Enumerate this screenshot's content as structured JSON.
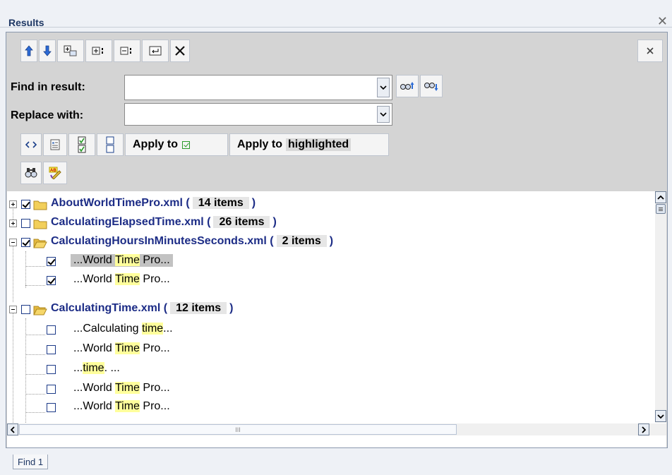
{
  "window": {
    "title": "Results"
  },
  "find": {
    "label": "Find in result:",
    "value": "",
    "placeholder": ""
  },
  "replace": {
    "label": "Replace with:",
    "value": "",
    "placeholder": ""
  },
  "toolbar": {
    "apply_to_label": "Apply to",
    "apply_to_highlighted_prefix": "Apply to",
    "apply_to_highlighted_word": "highlighted"
  },
  "tree": {
    "files": [
      {
        "name": "AboutWorldTimePro.xml (",
        "count": "14 items",
        "close": ")",
        "checked": true,
        "expanded": false
      },
      {
        "name": "CalculatingElapsedTime.xml (",
        "count": "26 items",
        "close": ")",
        "checked": false,
        "expanded": false
      },
      {
        "name": "CalculatingHoursInMinutesSeconds.xml (",
        "count": "2 items",
        "close": ")",
        "checked": true,
        "expanded": true
      },
      {
        "name": "CalculatingTime.xml (",
        "count": "12 items",
        "close": ")",
        "checked": false,
        "expanded": true
      }
    ],
    "hits": [
      {
        "pre": "...World ",
        "hl": "Time",
        "post": " Pro...",
        "checked": true,
        "selected": true
      },
      {
        "pre": "...World ",
        "hl": "Time",
        "post": " Pro...",
        "checked": true,
        "selected": false
      },
      {
        "pre": "...Calculating ",
        "hl": "time",
        "post": "...",
        "checked": false,
        "selected": false
      },
      {
        "pre": "...World ",
        "hl": "Time",
        "post": " Pro...",
        "checked": false,
        "selected": false
      },
      {
        "pre": "...",
        "hl": "time",
        "post": ". ...",
        "checked": false,
        "selected": false
      },
      {
        "pre": "...World ",
        "hl": "Time",
        "post": " Pro...",
        "checked": false,
        "selected": false
      },
      {
        "pre": "...World ",
        "hl": "Time",
        "post": " Pro...",
        "checked": false,
        "selected": false
      }
    ],
    "hscroll_thumb": "III"
  },
  "tabs": [
    {
      "label": "Find 1"
    }
  ],
  "colors": {
    "filename": "#1c2c86",
    "highlight": "#ffff9c",
    "selected_hit": "#c2c2c2",
    "title": "#1e3764"
  },
  "icons": [
    "arrow-up-icon",
    "arrow-down-icon",
    "expand-all-icon",
    "expand-icon",
    "collapse-icon",
    "wrap-icon",
    "close-icon",
    "find-previous-icon",
    "find-next-icon",
    "code-view-icon",
    "document-icon",
    "check-all-icon",
    "uncheck-all-icon",
    "find-icon",
    "spell-check-icon",
    "folder-icon"
  ]
}
